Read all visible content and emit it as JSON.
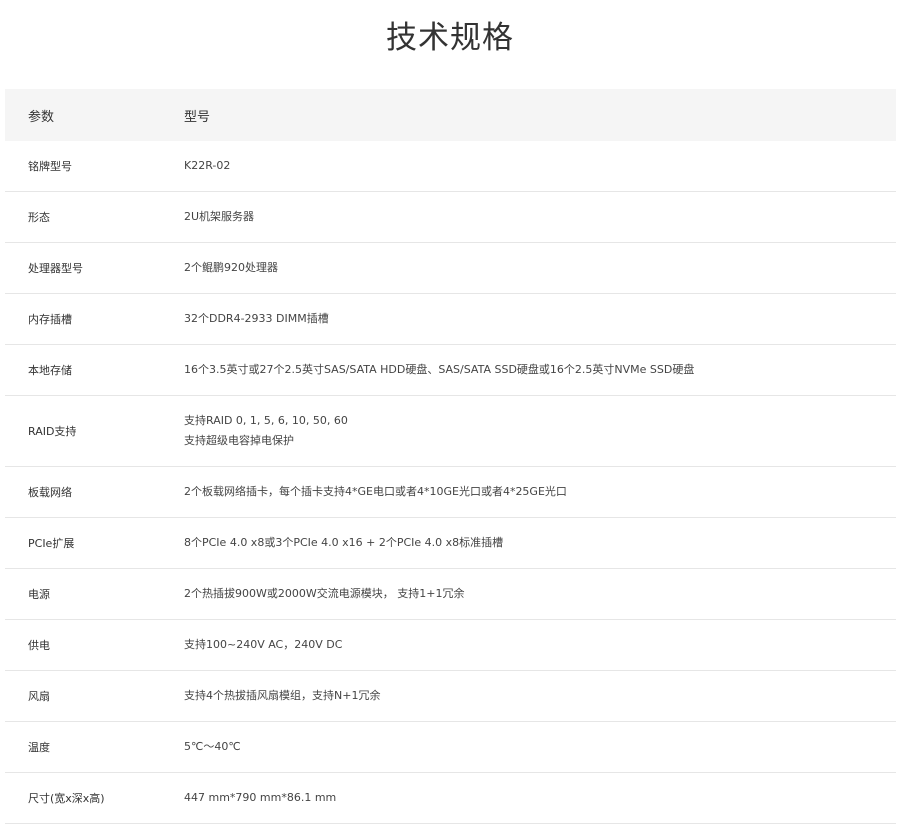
{
  "page": {
    "title": "技术规格"
  },
  "table": {
    "header": {
      "param": "参数",
      "value": "型号"
    },
    "rows": [
      {
        "param": "铭牌型号",
        "values": [
          "K22R-02"
        ]
      },
      {
        "param": "形态",
        "values": [
          "2U机架服务器"
        ]
      },
      {
        "param": "处理器型号",
        "values": [
          "2个鲲鹏920处理器"
        ]
      },
      {
        "param": "内存插槽",
        "values": [
          "32个DDR4-2933 DIMM插槽"
        ]
      },
      {
        "param": "本地存储",
        "values": [
          "16个3.5英寸或27个2.5英寸SAS/SATA HDD硬盘、SAS/SATA SSD硬盘或16个2.5英寸NVMe SSD硬盘"
        ]
      },
      {
        "param": "RAID支持",
        "values": [
          "支持RAID 0, 1, 5, 6, 10, 50, 60",
          "支持超级电容掉电保护"
        ]
      },
      {
        "param": "板载网络",
        "values": [
          "2个板载网络插卡，每个插卡支持4*GE电口或者4*10GE光口或者4*25GE光口"
        ]
      },
      {
        "param": "PCIe扩展",
        "values": [
          "8个PCIe 4.0 x8或3个PCIe 4.0 x16 + 2个PCIe 4.0 x8标准插槽"
        ]
      },
      {
        "param": "电源",
        "values": [
          "2个热插拔900W或2000W交流电源模块， 支持1+1冗余"
        ]
      },
      {
        "param": "供电",
        "values": [
          "支持100~240V AC，240V DC"
        ]
      },
      {
        "param": "风扇",
        "values": [
          "支持4个热拔插风扇模组，支持N+1冗余"
        ]
      },
      {
        "param": "温度",
        "values": [
          "5℃～40℃"
        ]
      },
      {
        "param": "尺寸(宽x深x高)",
        "values": [
          "447 mm*790 mm*86.1 mm"
        ]
      }
    ]
  }
}
